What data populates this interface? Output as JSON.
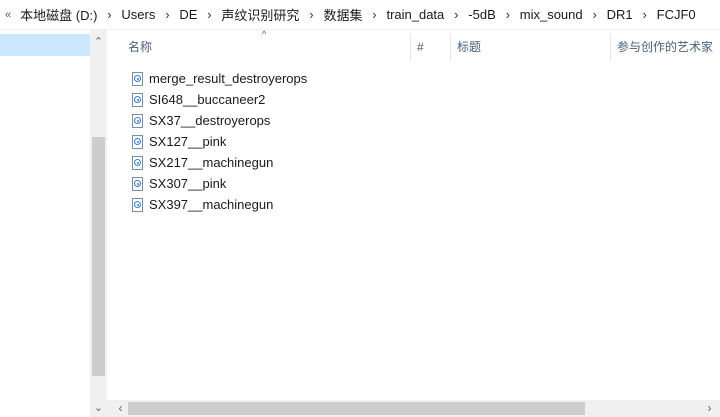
{
  "breadcrumb": {
    "overflow": "«",
    "separator": "›",
    "items": [
      "本地磁盘 (D:)",
      "Users",
      "DE",
      "声纹识别研究",
      "数据集",
      "train_data",
      "-5dB",
      "mix_sound",
      "DR1",
      "FCJF0"
    ]
  },
  "columns": {
    "name": "名称",
    "number": "#",
    "title": "标题",
    "artist": "参与创作的艺术家",
    "sort_indicator": "^"
  },
  "files": [
    {
      "name": "merge_result_destroyerops",
      "icon": "audio-file-icon"
    },
    {
      "name": "SI648__buccaneer2",
      "icon": "audio-file-icon"
    },
    {
      "name": "SX37__destroyerops",
      "icon": "audio-file-icon"
    },
    {
      "name": "SX127__pink",
      "icon": "audio-file-icon"
    },
    {
      "name": "SX217__machinegun",
      "icon": "audio-file-icon"
    },
    {
      "name": "SX307__pink",
      "icon": "audio-file-icon"
    },
    {
      "name": "SX397__machinegun",
      "icon": "audio-file-icon"
    }
  ],
  "scrollbars": {
    "up_arrow": "⌃",
    "down_arrow": "⌄",
    "left_arrow": "‹",
    "right_arrow": "›"
  },
  "colors": {
    "selection": "#cce8ff",
    "header_text": "#4c607a",
    "scrollbar_track": "#f0f0f0",
    "scrollbar_thumb": "#cdcdcd"
  }
}
